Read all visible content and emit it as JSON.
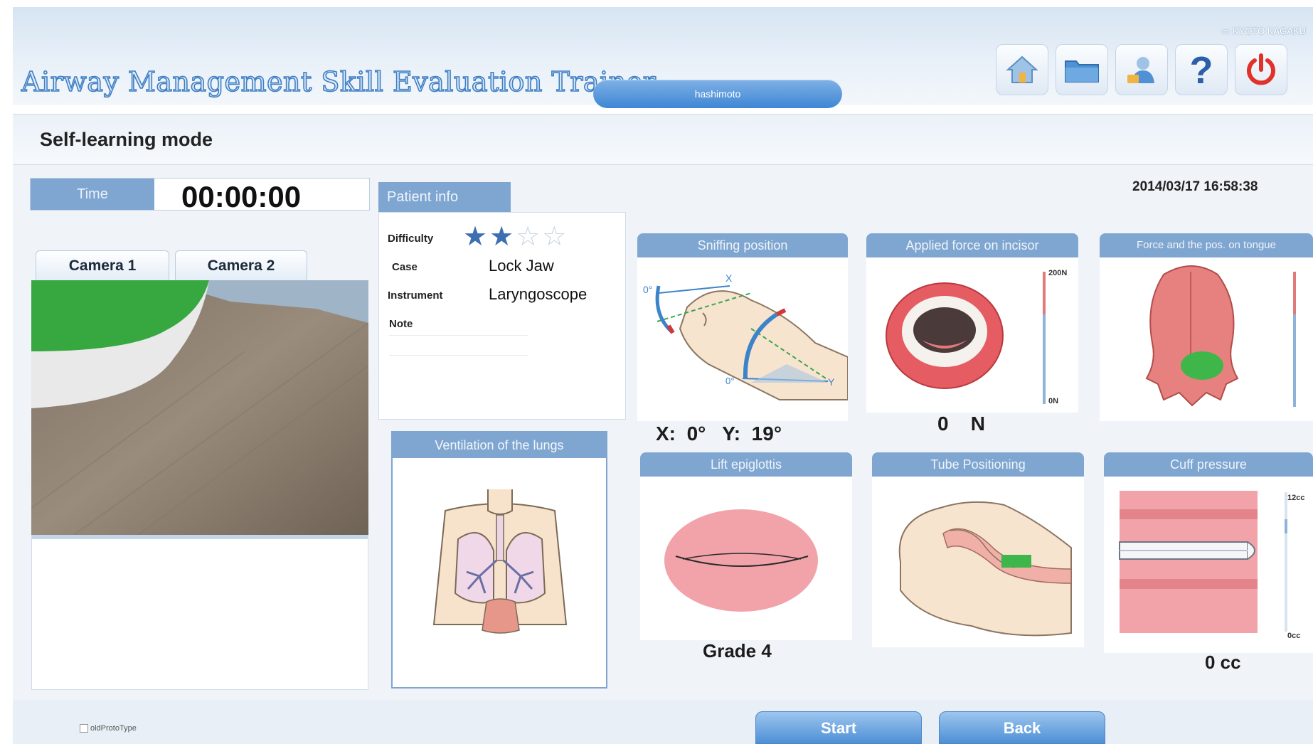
{
  "header": {
    "app_title": "Airway Management Skill Evaluation Trainer",
    "user_name": "hashimoto",
    "brand": "KYOTO KAGAKU",
    "icons": [
      "home-icon",
      "folder-icon",
      "user-icon",
      "help-icon",
      "power-icon"
    ]
  },
  "mode": {
    "title": "Self-learning mode"
  },
  "timer": {
    "label": "Time",
    "value": "00:00:00"
  },
  "camera": {
    "tabs": [
      "Camera 1",
      "Camera 2"
    ],
    "active_tab": 0
  },
  "patient_info": {
    "title": "Patient info",
    "difficulty_label": "Difficulty",
    "difficulty_stars": 2,
    "difficulty_max": 4,
    "case_label": "Case",
    "case_value": "Lock Jaw",
    "instrument_label": "Instrument",
    "instrument_value": "Laryngoscope",
    "note_label": "Note"
  },
  "datetime": "2014/03/17 16:58:38",
  "panels": {
    "ventilation": {
      "title": "Ventilation of the lungs"
    },
    "sniffing": {
      "title": "Sniffing position",
      "x_label": "X:",
      "x_value": "0",
      "y_label": "Y:",
      "y_value": "19",
      "unit": "°",
      "diagram_labels": {
        "axis_x": "X",
        "axis_y": "Y",
        "deg_top": "0°",
        "deg_bottom": "0°"
      }
    },
    "incisor": {
      "title": "Applied force on incisor",
      "value": "0",
      "unit": "N",
      "scale_max": "200N",
      "scale_min": "0N"
    },
    "tongue": {
      "title": "Force and the pos. on tongue"
    },
    "epiglottis": {
      "title": "Lift epiglottis",
      "grade": "Grade 4"
    },
    "tube": {
      "title": "Tube Positioning"
    },
    "cuff": {
      "title": "Cuff pressure",
      "value": "0 cc",
      "scale_max": "12cc",
      "scale_min": "0cc"
    }
  },
  "footer": {
    "prototype_checkbox": "oldProtoType",
    "start_label": "Start",
    "back_label": "Back"
  },
  "colors": {
    "panel_header": "#7fa6d0",
    "star_active": "#3e6fb0",
    "button_blue": "#4e8fd6",
    "power_red": "#e0322b"
  }
}
